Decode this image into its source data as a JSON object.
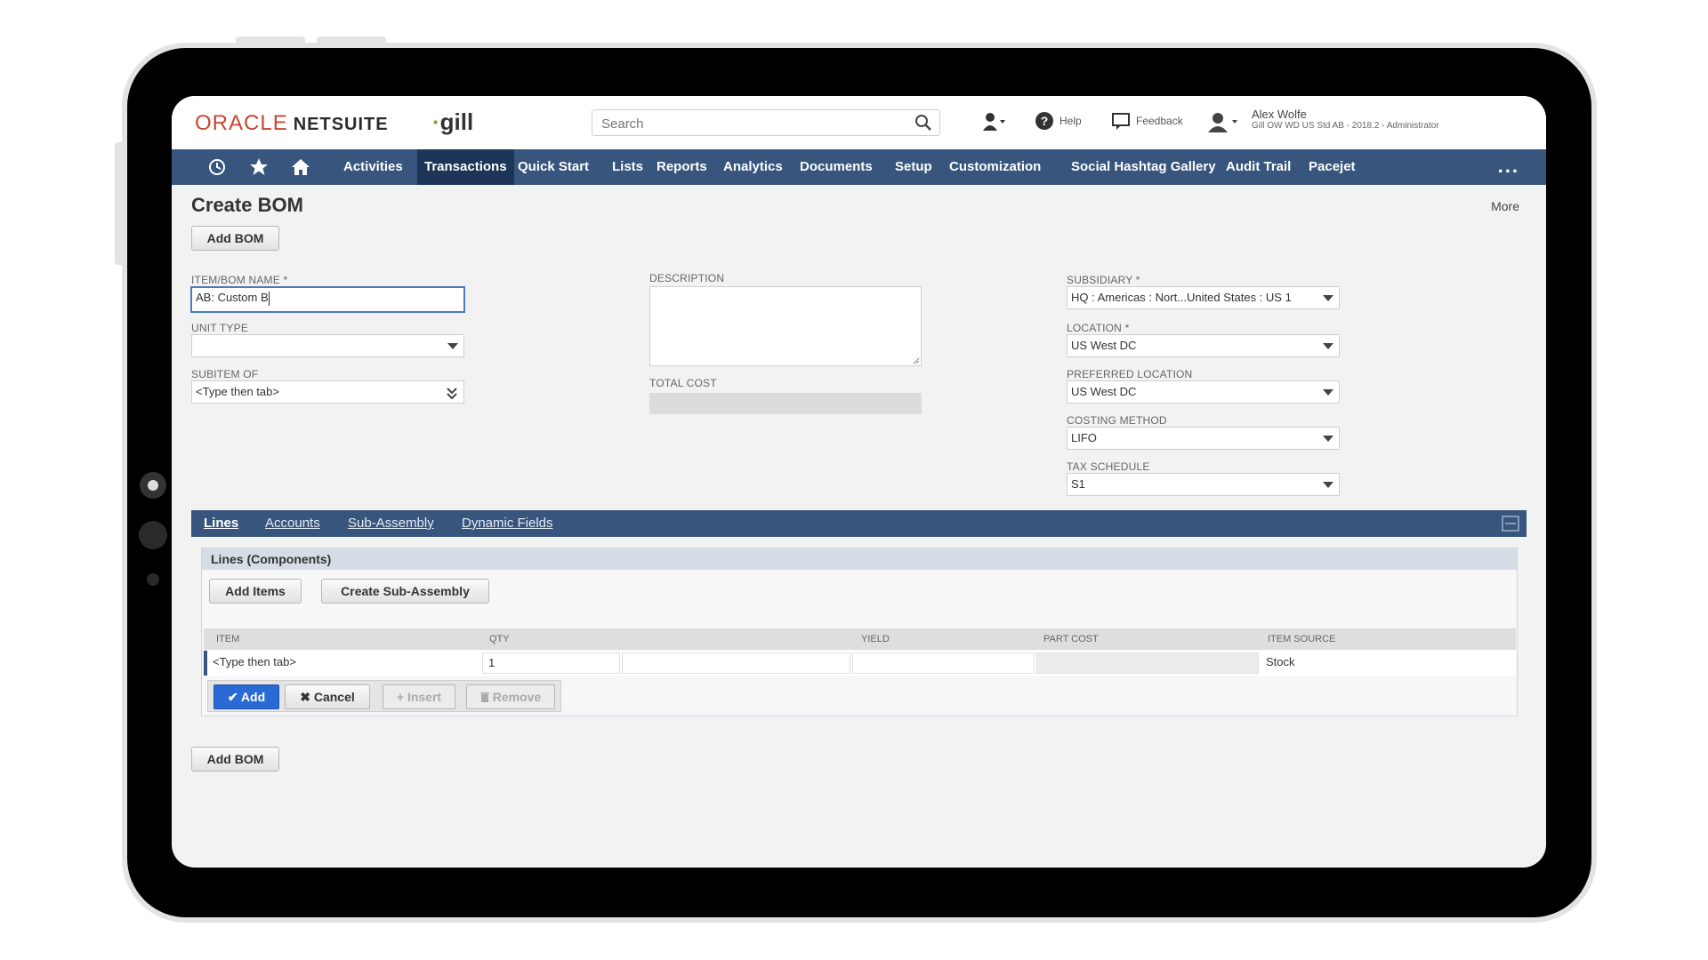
{
  "header": {
    "logo_oracle": "ORACLE",
    "logo_netsuite": "NETSUITE",
    "brand": "gill",
    "search_placeholder": "Search",
    "help_label": "Help",
    "feedback_label": "Feedback",
    "user_name": "Alex Wolfe",
    "user_role": "Gill OW WD US Std AB - 2018.2 - Administrator"
  },
  "nav": {
    "items": [
      "Activities",
      "Transactions",
      "Quick Start",
      "Lists",
      "Reports",
      "Analytics",
      "Documents",
      "Setup",
      "Customization",
      "Social Hashtag Gallery",
      "Audit Trail",
      "Pacejet"
    ],
    "active": "Transactions",
    "more": "..."
  },
  "page": {
    "title": "Create BOM",
    "more_label": "More",
    "add_bom_label": "Add BOM"
  },
  "form": {
    "item_bom_name_label": "ITEM/BOM NAME *",
    "item_bom_name_value": "AB: Custom B",
    "unit_type_label": "UNIT TYPE",
    "unit_type_value": "",
    "subitem_of_label": "SUBITEM OF",
    "subitem_of_value": "<Type then tab>",
    "description_label": "DESCRIPTION",
    "total_cost_label": "TOTAL COST",
    "subsidiary_label": "SUBSIDIARY *",
    "subsidiary_value": "HQ : Americas : Nort...United States : US 1",
    "location_label": "LOCATION *",
    "location_value": "US West DC",
    "preferred_location_label": "PREFERRED LOCATION",
    "preferred_location_value": "US West DC",
    "costing_method_label": "COSTING METHOD",
    "costing_method_value": "LIFO",
    "tax_schedule_label": "TAX SCHEDULE",
    "tax_schedule_value": "S1"
  },
  "tabs": {
    "items": [
      "Lines",
      "Accounts",
      "Sub-Assembly",
      "Dynamic Fields"
    ],
    "active": "Lines"
  },
  "lines": {
    "title": "Lines (Components)",
    "add_items_label": "Add Items",
    "create_subassembly_label": "Create Sub-Assembly",
    "columns": [
      "ITEM",
      "QTY",
      "YIELD",
      "PART COST",
      "ITEM SOURCE"
    ],
    "row": {
      "item": "<Type then tab>",
      "qty": "1",
      "yield": "",
      "part_cost": "",
      "item_source": "Stock"
    },
    "actions": {
      "add": "✔ Add",
      "cancel": "✖ Cancel",
      "insert": "+ Insert",
      "remove": "Remove"
    }
  },
  "colors": {
    "nav_bg": "#38557d",
    "nav_active": "#1d3557",
    "oracle_red": "#c74634",
    "primary_button": "#2a6ad4"
  }
}
